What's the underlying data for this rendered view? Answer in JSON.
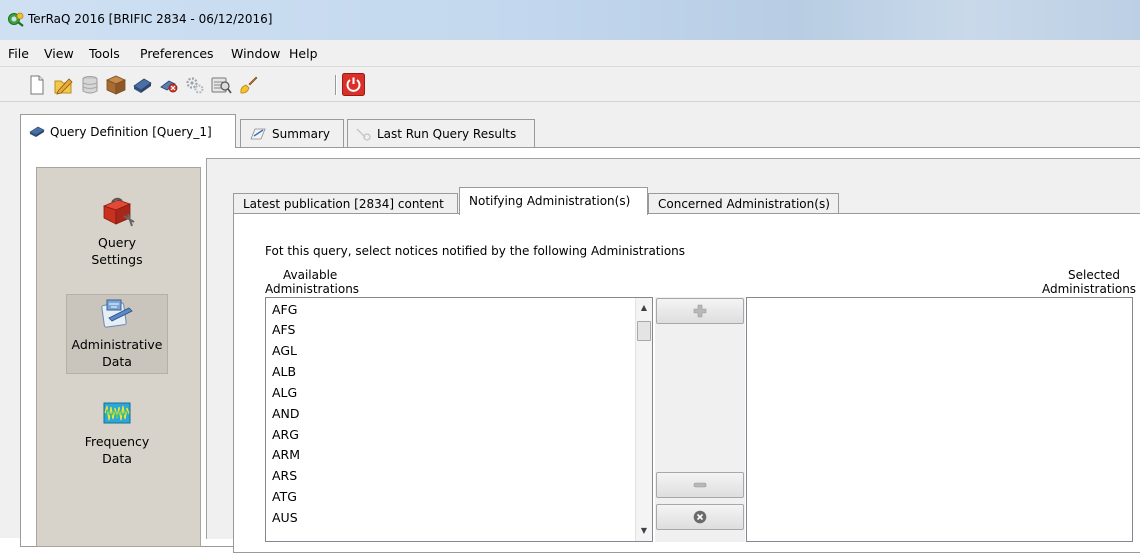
{
  "window": {
    "title": "TerRaQ 2016 [BRIFIC 2834 - 06/12/2016]",
    "icons": [
      "app-logo-icon"
    ]
  },
  "menu": [
    "File",
    "View",
    "Tools",
    "Preferences",
    "Window",
    "Help"
  ],
  "toolbar": {
    "icons": [
      "new-document-icon",
      "edit-pencil-icon",
      "database-icon",
      "package-icon",
      "run-query-icon",
      "connect-icon",
      "settings-gears-icon",
      "inspect-icon",
      "brush-icon",
      "power-icon"
    ]
  },
  "main_tabs": [
    {
      "label": "Query Definition [Query_1]",
      "icon": "query-icon",
      "active": true
    },
    {
      "label": "Summary",
      "icon": "summary-icon",
      "active": false
    },
    {
      "label": "Last Run Query Results",
      "icon": "search-results-icon",
      "active": false
    }
  ],
  "nav": [
    {
      "label_line1": "Query",
      "label_line2": "Settings",
      "icon": "toolbox-icon",
      "selected": false
    },
    {
      "label_line1": "Administrative",
      "label_line2": "Data",
      "icon": "admin-data-icon",
      "selected": true
    },
    {
      "label_line1": "Frequency",
      "label_line2": "Data",
      "icon": "frequency-waveform-icon",
      "selected": false
    }
  ],
  "sub_tabs": [
    {
      "label": "Latest publication [2834] content",
      "active": false
    },
    {
      "label": "Notifying Administration(s)",
      "active": true
    },
    {
      "label": "Concerned Administration(s)",
      "active": false
    }
  ],
  "instruction": "Fot this query, select notices notified by the following Administrations",
  "available_label": {
    "line1": "Available",
    "line2": "Administrations"
  },
  "selected_label": {
    "line1": "Selected",
    "line2": "Administrations"
  },
  "available_items": [
    "AFG",
    "AFS",
    "AGL",
    "ALB",
    "ALG",
    "AND",
    "ARG",
    "ARM",
    "ARS",
    "ATG",
    "AUS"
  ],
  "selected_items": [],
  "transfer_buttons": {
    "icons": [
      "add-plus-icon",
      "remove-minus-icon",
      "clear-x-icon"
    ]
  },
  "colors": {
    "nav_background": "#d8d3ca",
    "power_button": "#d9302a"
  }
}
